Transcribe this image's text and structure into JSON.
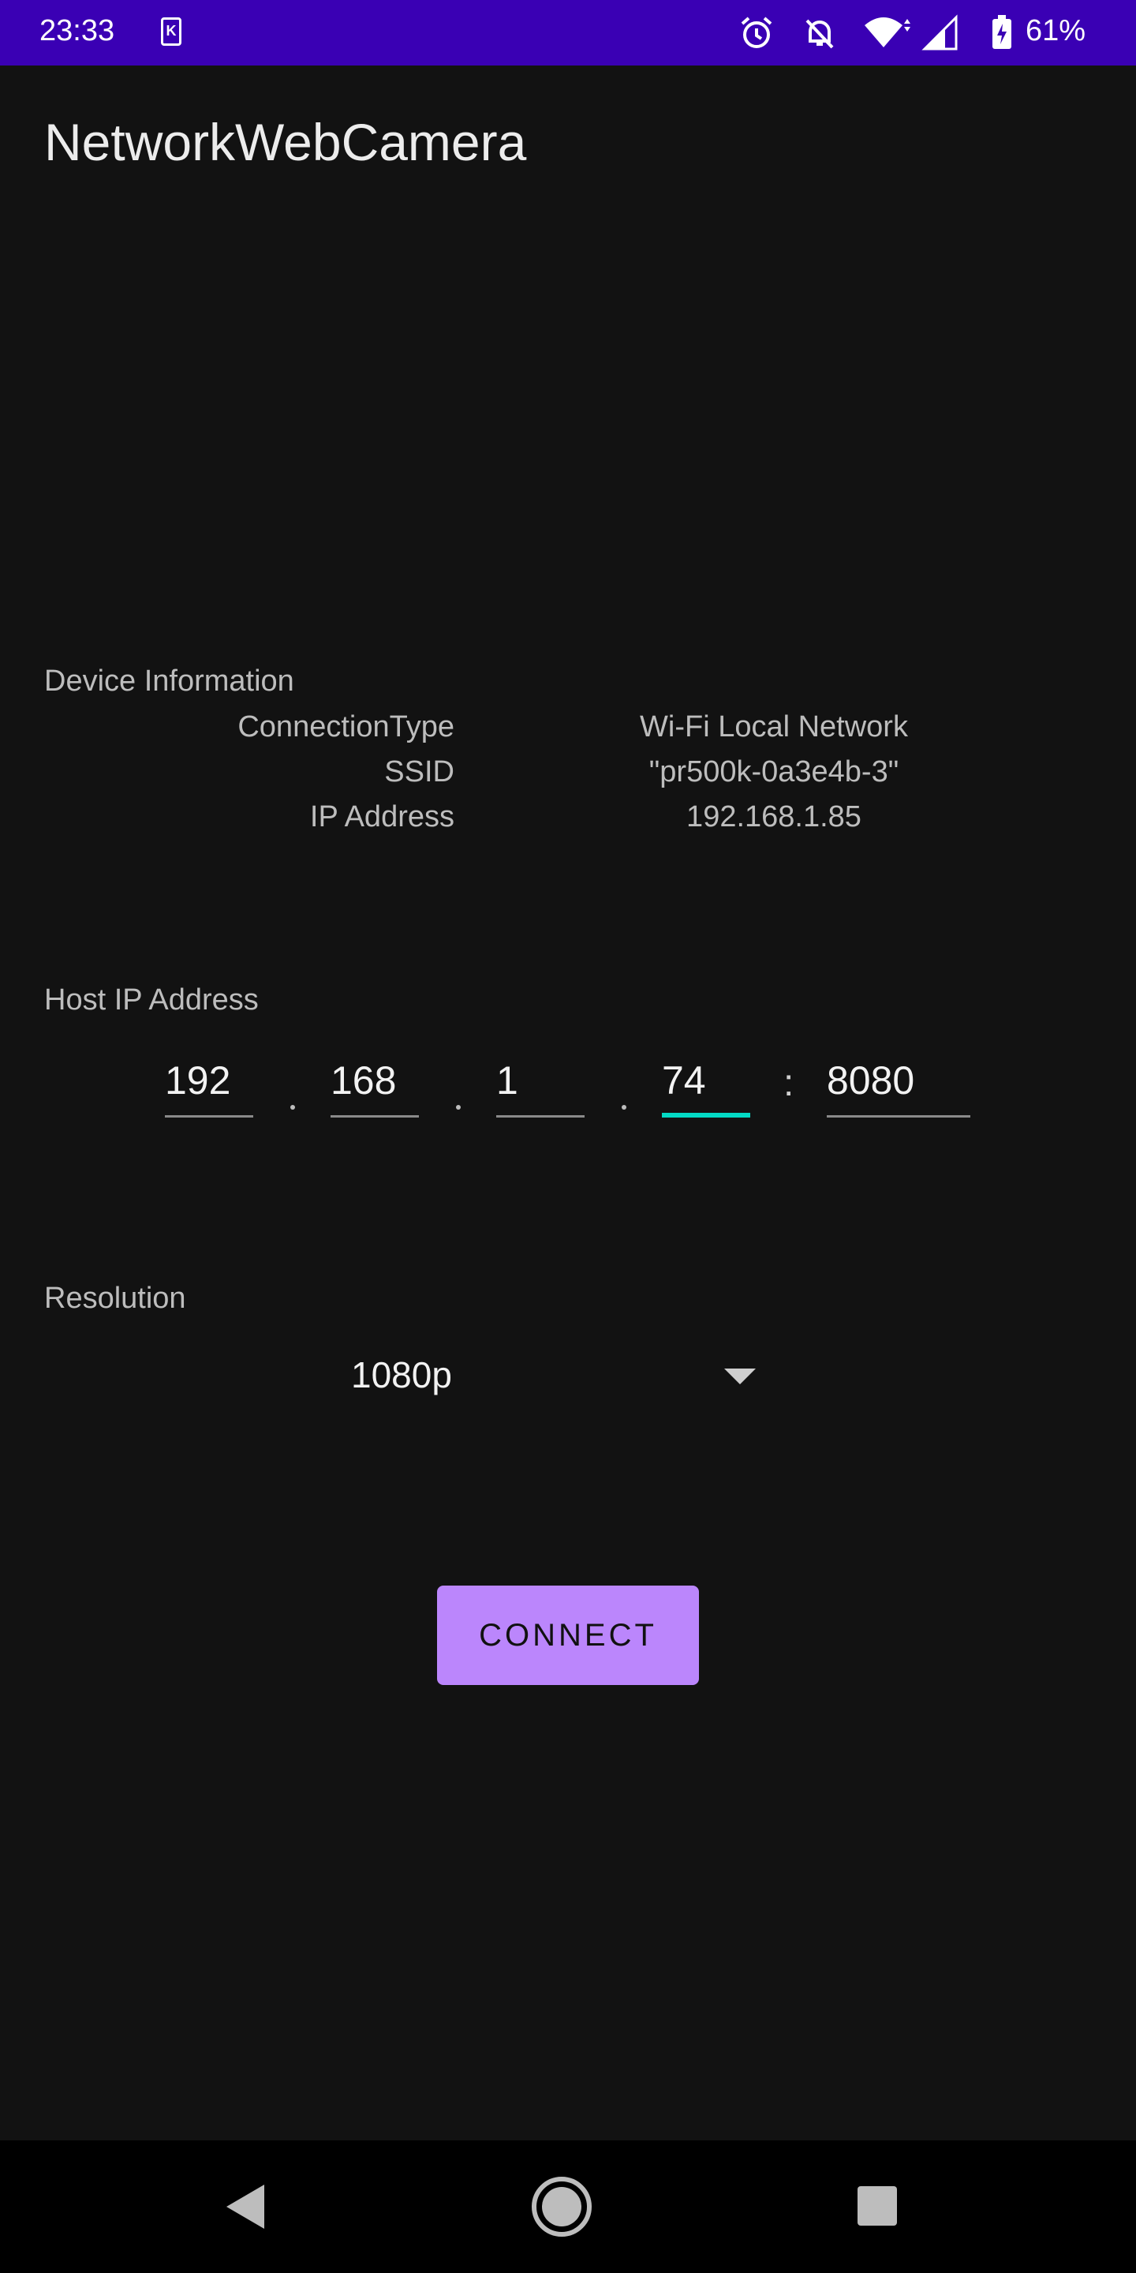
{
  "status_bar": {
    "time": "23:33",
    "battery": "61%",
    "icons": [
      "k-app-icon",
      "alarm-icon",
      "notifications-off-icon",
      "wifi-icon",
      "signal-icon",
      "battery-charging-icon"
    ]
  },
  "app_bar": {
    "title": "NetworkWebCamera"
  },
  "device_info": {
    "heading": "Device Information",
    "rows": [
      {
        "key": "ConnectionType",
        "value": "Wi-Fi Local Network"
      },
      {
        "key": "SSID",
        "value": "\"pr500k-0a3e4b-3\""
      },
      {
        "key": "IP Address",
        "value": "192.168.1.85"
      }
    ]
  },
  "host": {
    "heading": "Host IP Address",
    "octets": [
      "192",
      "168",
      "1",
      "74"
    ],
    "separator": ":",
    "port": "8080",
    "focused_field": 3
  },
  "resolution": {
    "heading": "Resolution",
    "selected": "1080p"
  },
  "actions": {
    "connect_label": "CONNECT"
  },
  "colors": {
    "status_bar": "#3a00b4",
    "background": "#121212",
    "accent": "#bb86fc",
    "focus_underline": "#03dac5"
  }
}
